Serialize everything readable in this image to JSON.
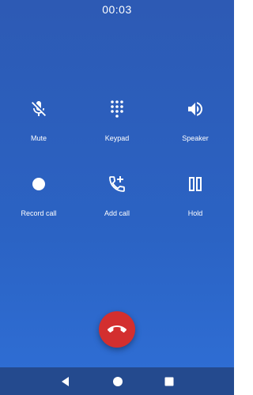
{
  "call": {
    "timer": "00:03"
  },
  "controls": [
    {
      "label": "Mute",
      "icon": "mic-off-icon"
    },
    {
      "label": "Keypad",
      "icon": "dialpad-icon"
    },
    {
      "label": "Speaker",
      "icon": "volume-icon"
    },
    {
      "label": "Record call",
      "icon": "record-dot-icon"
    },
    {
      "label": "Add call",
      "icon": "add-call-icon"
    },
    {
      "label": "Hold",
      "icon": "pause-icon"
    }
  ],
  "end_call": {
    "icon": "call-end-icon",
    "color": "#d32f2f"
  },
  "navbar": {
    "buttons": [
      {
        "icon": "back-triangle-icon"
      },
      {
        "icon": "home-circle-icon"
      },
      {
        "icon": "recents-square-icon"
      }
    ]
  },
  "colors": {
    "background_top": "#2d5ab4",
    "background_bottom": "#2f6fd6",
    "navbar": "#244a8e"
  }
}
